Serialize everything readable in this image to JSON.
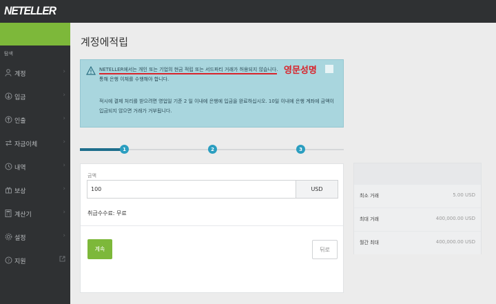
{
  "app": {
    "logo": "NETELLER"
  },
  "sidebar": {
    "header": "탐색",
    "items": [
      {
        "label": "계정",
        "icon": "user-icon"
      },
      {
        "label": "입금",
        "icon": "deposit-icon"
      },
      {
        "label": "인출",
        "icon": "withdraw-icon"
      },
      {
        "label": "자금이체",
        "icon": "transfer-icon"
      },
      {
        "label": "내역",
        "icon": "history-icon"
      },
      {
        "label": "보상",
        "icon": "gift-icon"
      },
      {
        "label": "계산기",
        "icon": "calculator-icon"
      },
      {
        "label": "설정",
        "icon": "gear-icon"
      },
      {
        "label": "지원",
        "icon": "help-icon"
      }
    ]
  },
  "main": {
    "title": "계정에적립",
    "alert": {
      "line1": "NETELLER에서는 개인 또는 기업의 현금 적립 또는 서드파티 거래가 허용되지 않습니다.",
      "red_label": "영문성명",
      "line2": "통해 은행 이체를 수행해야 합니다.",
      "paragraph": "적시에 결제 처리를 받으려면 영업일 기준 2 일 이내에 은행에 입금을 완료하십시오. 10일 이내에 은행 계좌에 금액이 입금되지 않으면 거래가 거부됩니다."
    },
    "steps": [
      "1",
      "2",
      "3"
    ],
    "form": {
      "amount_label": "금액",
      "amount_value": "100",
      "currency": "USD",
      "fee": "취급수수료: 무료",
      "continue_label": "계속",
      "back_label": "뒤로"
    },
    "limits": {
      "rows": [
        {
          "label": "최소 거래",
          "value": "5.00 USD"
        },
        {
          "label": "최대 거래",
          "value": "400,000.00 USD"
        },
        {
          "label": "월간 최대",
          "value": "400,000.00 USD"
        }
      ]
    }
  },
  "colors": {
    "accent_green": "#7db83a",
    "alert_bg": "#a9d6de",
    "step_blue": "#2b9ec0",
    "annotation_red": "#d9232a",
    "sidebar_bg": "#2f3133"
  }
}
